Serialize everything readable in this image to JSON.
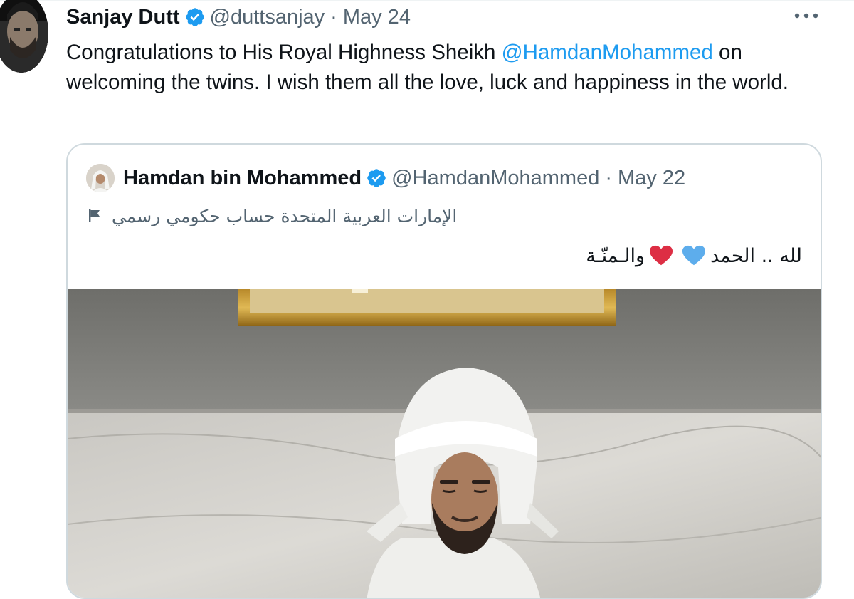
{
  "tweet": {
    "author_name": "Sanjay Dutt",
    "author_handle": "@duttsanjay",
    "separator": "·",
    "date": "May 24",
    "more_label": "•••",
    "text_before": "Congratulations to His Royal Highness Sheikh ",
    "mention": "@HamdanMohammed",
    "text_after": " on welcoming the twins. I wish them all the love, luck and happiness in the world."
  },
  "quoted_tweet": {
    "author_name": "Hamdan bin Mohammed",
    "author_handle": "@HamdanMohammed",
    "separator": "·",
    "date": "May 22",
    "account_label": "الإمارات العربية المتحدة حساب حكومي رسمي",
    "text_part1": "لله .. الحمد",
    "text_part2": "والـمنّـة"
  },
  "colors": {
    "accent": "#1d9bf0",
    "secondary_text": "#536471",
    "border": "#cfd9de",
    "blue_heart": "#5dadec",
    "red_heart": "#dd2e44"
  },
  "icons": {
    "verified": "verified-badge-icon",
    "more": "more-options-icon",
    "flag": "flag-icon",
    "blue_heart": "blue-heart-icon",
    "red_heart": "red-heart-icon"
  }
}
